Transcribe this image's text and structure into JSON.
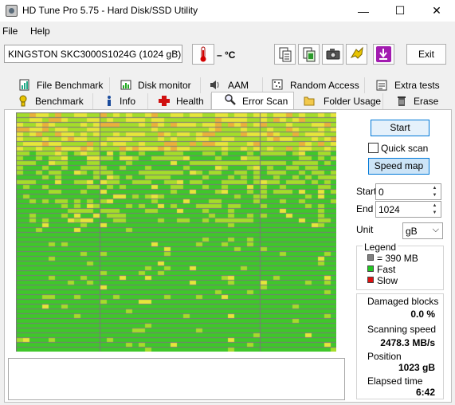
{
  "window": {
    "title": "HD Tune Pro 5.75 - Hard Disk/SSD Utility",
    "minimize": "—",
    "maximize": "☐",
    "close": "✕"
  },
  "menu": [
    "File",
    "Help"
  ],
  "toolbar": {
    "drive": "KINGSTON SKC3000S1024G (1024 gB)",
    "temperature": "– °C",
    "exit_label": "Exit",
    "icons": [
      "copy-text-icon",
      "copy-screenshot-icon",
      "camera-icon",
      "options-icon",
      "save-icon"
    ]
  },
  "tabs": {
    "row1": [
      "File Benchmark",
      "Disk monitor",
      "AAM",
      "Random Access",
      "Extra tests"
    ],
    "row2": [
      "Benchmark",
      "Info",
      "Health",
      "Error Scan",
      "Folder Usage",
      "Erase"
    ],
    "active": "Error Scan"
  },
  "controls": {
    "start_label": "Start",
    "quick_scan_label": "Quick scan",
    "quick_scan_checked": false,
    "speed_map_label": "Speed map",
    "start_field_label": "Start",
    "start_value": "0",
    "end_field_label": "End",
    "end_value": "1024",
    "unit_label": "Unit",
    "unit_value": "gB"
  },
  "legend": {
    "title": "Legend",
    "items": [
      {
        "color": "#808080",
        "label": "= 390 MB"
      },
      {
        "color": "#22c922",
        "label": "Fast"
      },
      {
        "color": "#e01010",
        "label": "Slow"
      }
    ]
  },
  "stats": {
    "damaged_label": "Damaged blocks",
    "damaged_value": "0.0 %",
    "speed_label": "Scanning speed",
    "speed_value": "2478.3 MB/s",
    "position_label": "Position",
    "position_value": "1023 gB",
    "elapsed_label": "Elapsed time",
    "elapsed_value": "6:42"
  },
  "scan_map": {
    "colors": {
      "border": "#7a7a7a",
      "yellow": "#e6e63a",
      "orange": "#e9b13a",
      "lime": "#a4dd2a",
      "green": "#3fc72a"
    }
  }
}
